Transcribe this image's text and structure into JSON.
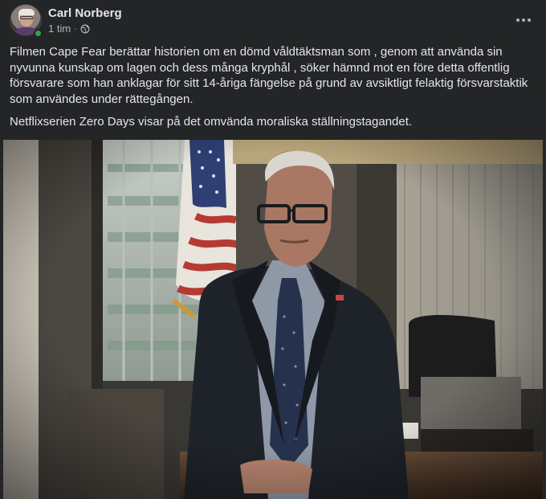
{
  "post": {
    "author": "Carl Norberg",
    "time": "1 tim",
    "separator": "·",
    "privacy_icon": "globe-icon",
    "more_icon": "more-horizontal-icon",
    "paragraphs": [
      "Filmen Cape Fear berättar historien om en dömd våldtäktsman som , genom att använda sin nyvunna kunskap om lagen och dess många kryphål , söker hämnd mot en före detta offentlig försvarare som han anklagar för sitt 14-åriga fängelse på grund av avsiktligt felaktig försvarstaktik som användes under rättegången.",
      "Netflixserien Zero Days visar på det omvända moraliska ställningstagandet."
    ]
  },
  "colors": {
    "background": "#242526",
    "primary_text": "#e4e6eb",
    "secondary_text": "#b0b3b8",
    "online": "#31a24c"
  }
}
